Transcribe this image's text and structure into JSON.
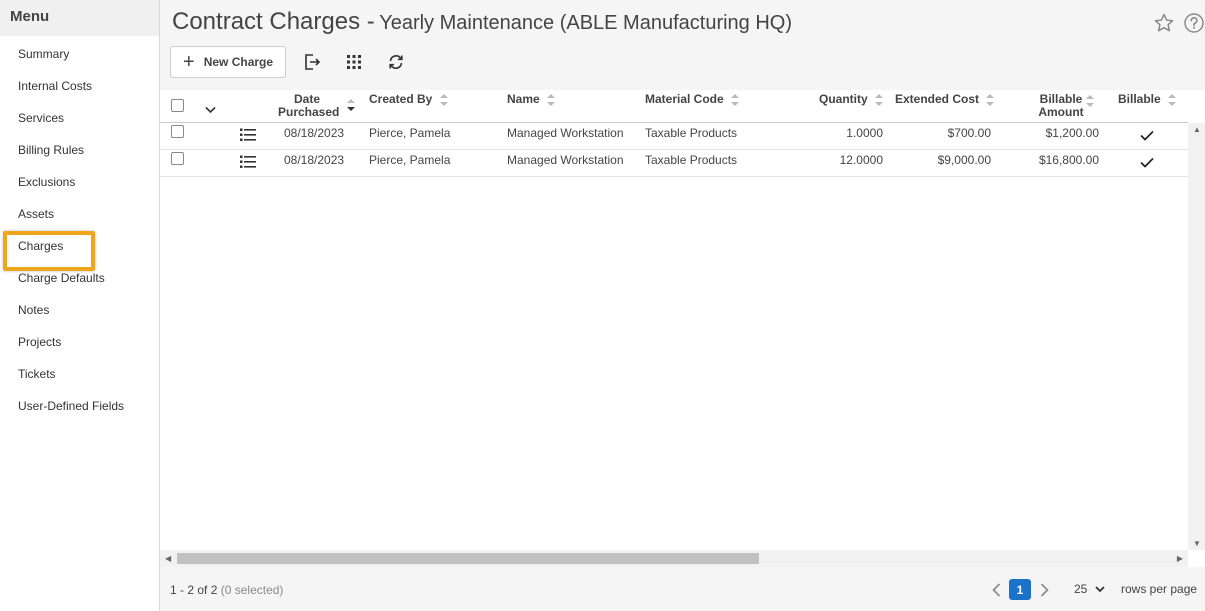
{
  "sidebar": {
    "title": "Menu",
    "items": [
      {
        "label": "Summary"
      },
      {
        "label": "Internal Costs"
      },
      {
        "label": "Services"
      },
      {
        "label": "Billing Rules"
      },
      {
        "label": "Exclusions"
      },
      {
        "label": "Assets"
      },
      {
        "label": "Charges",
        "active": true
      },
      {
        "label": "Charge Defaults"
      },
      {
        "label": "Notes"
      },
      {
        "label": "Projects"
      },
      {
        "label": "Tickets"
      },
      {
        "label": "User-Defined Fields"
      }
    ]
  },
  "header": {
    "title": "Contract Charges -",
    "subtitle": "Yearly Maintenance (ABLE Manufacturing HQ)",
    "icons": [
      "star-icon",
      "help-icon"
    ]
  },
  "toolbar": {
    "new_charge_label": "New Charge",
    "icons": [
      "export-icon",
      "column-chooser-icon",
      "refresh-icon"
    ]
  },
  "grid": {
    "columns": {
      "date_purchased_1": "Date",
      "date_purchased_2": "Purchased",
      "created_by": "Created By",
      "name": "Name",
      "material_code": "Material Code",
      "quantity": "Quantity",
      "extended_cost": "Extended Cost",
      "billable_amount_1": "Billable",
      "billable_amount_2": "Amount",
      "billable": "Billable"
    },
    "sorted_column": "Date Purchased",
    "rows": [
      {
        "date_purchased": "08/18/2023",
        "created_by": "Pierce, Pamela",
        "name": "Managed Workstation",
        "material_code": "Taxable Products",
        "quantity": "1.0000",
        "extended_cost": "$700.00",
        "billable_amount": "$1,200.00",
        "billable": true
      },
      {
        "date_purchased": "08/18/2023",
        "created_by": "Pierce, Pamela",
        "name": "Managed Workstation",
        "material_code": "Taxable Products",
        "quantity": "12.0000",
        "extended_cost": "$9,000.00",
        "billable_amount": "$16,800.00",
        "billable": true
      }
    ]
  },
  "footer": {
    "count": "1 - 2 of 2",
    "selected": "(0 selected)",
    "current_page": "1",
    "rows_per_page": "25",
    "rows_per_page_label": "rows per page"
  },
  "colors": {
    "accent_highlight": "#f0a61c",
    "pager_active": "#1a73c8"
  }
}
